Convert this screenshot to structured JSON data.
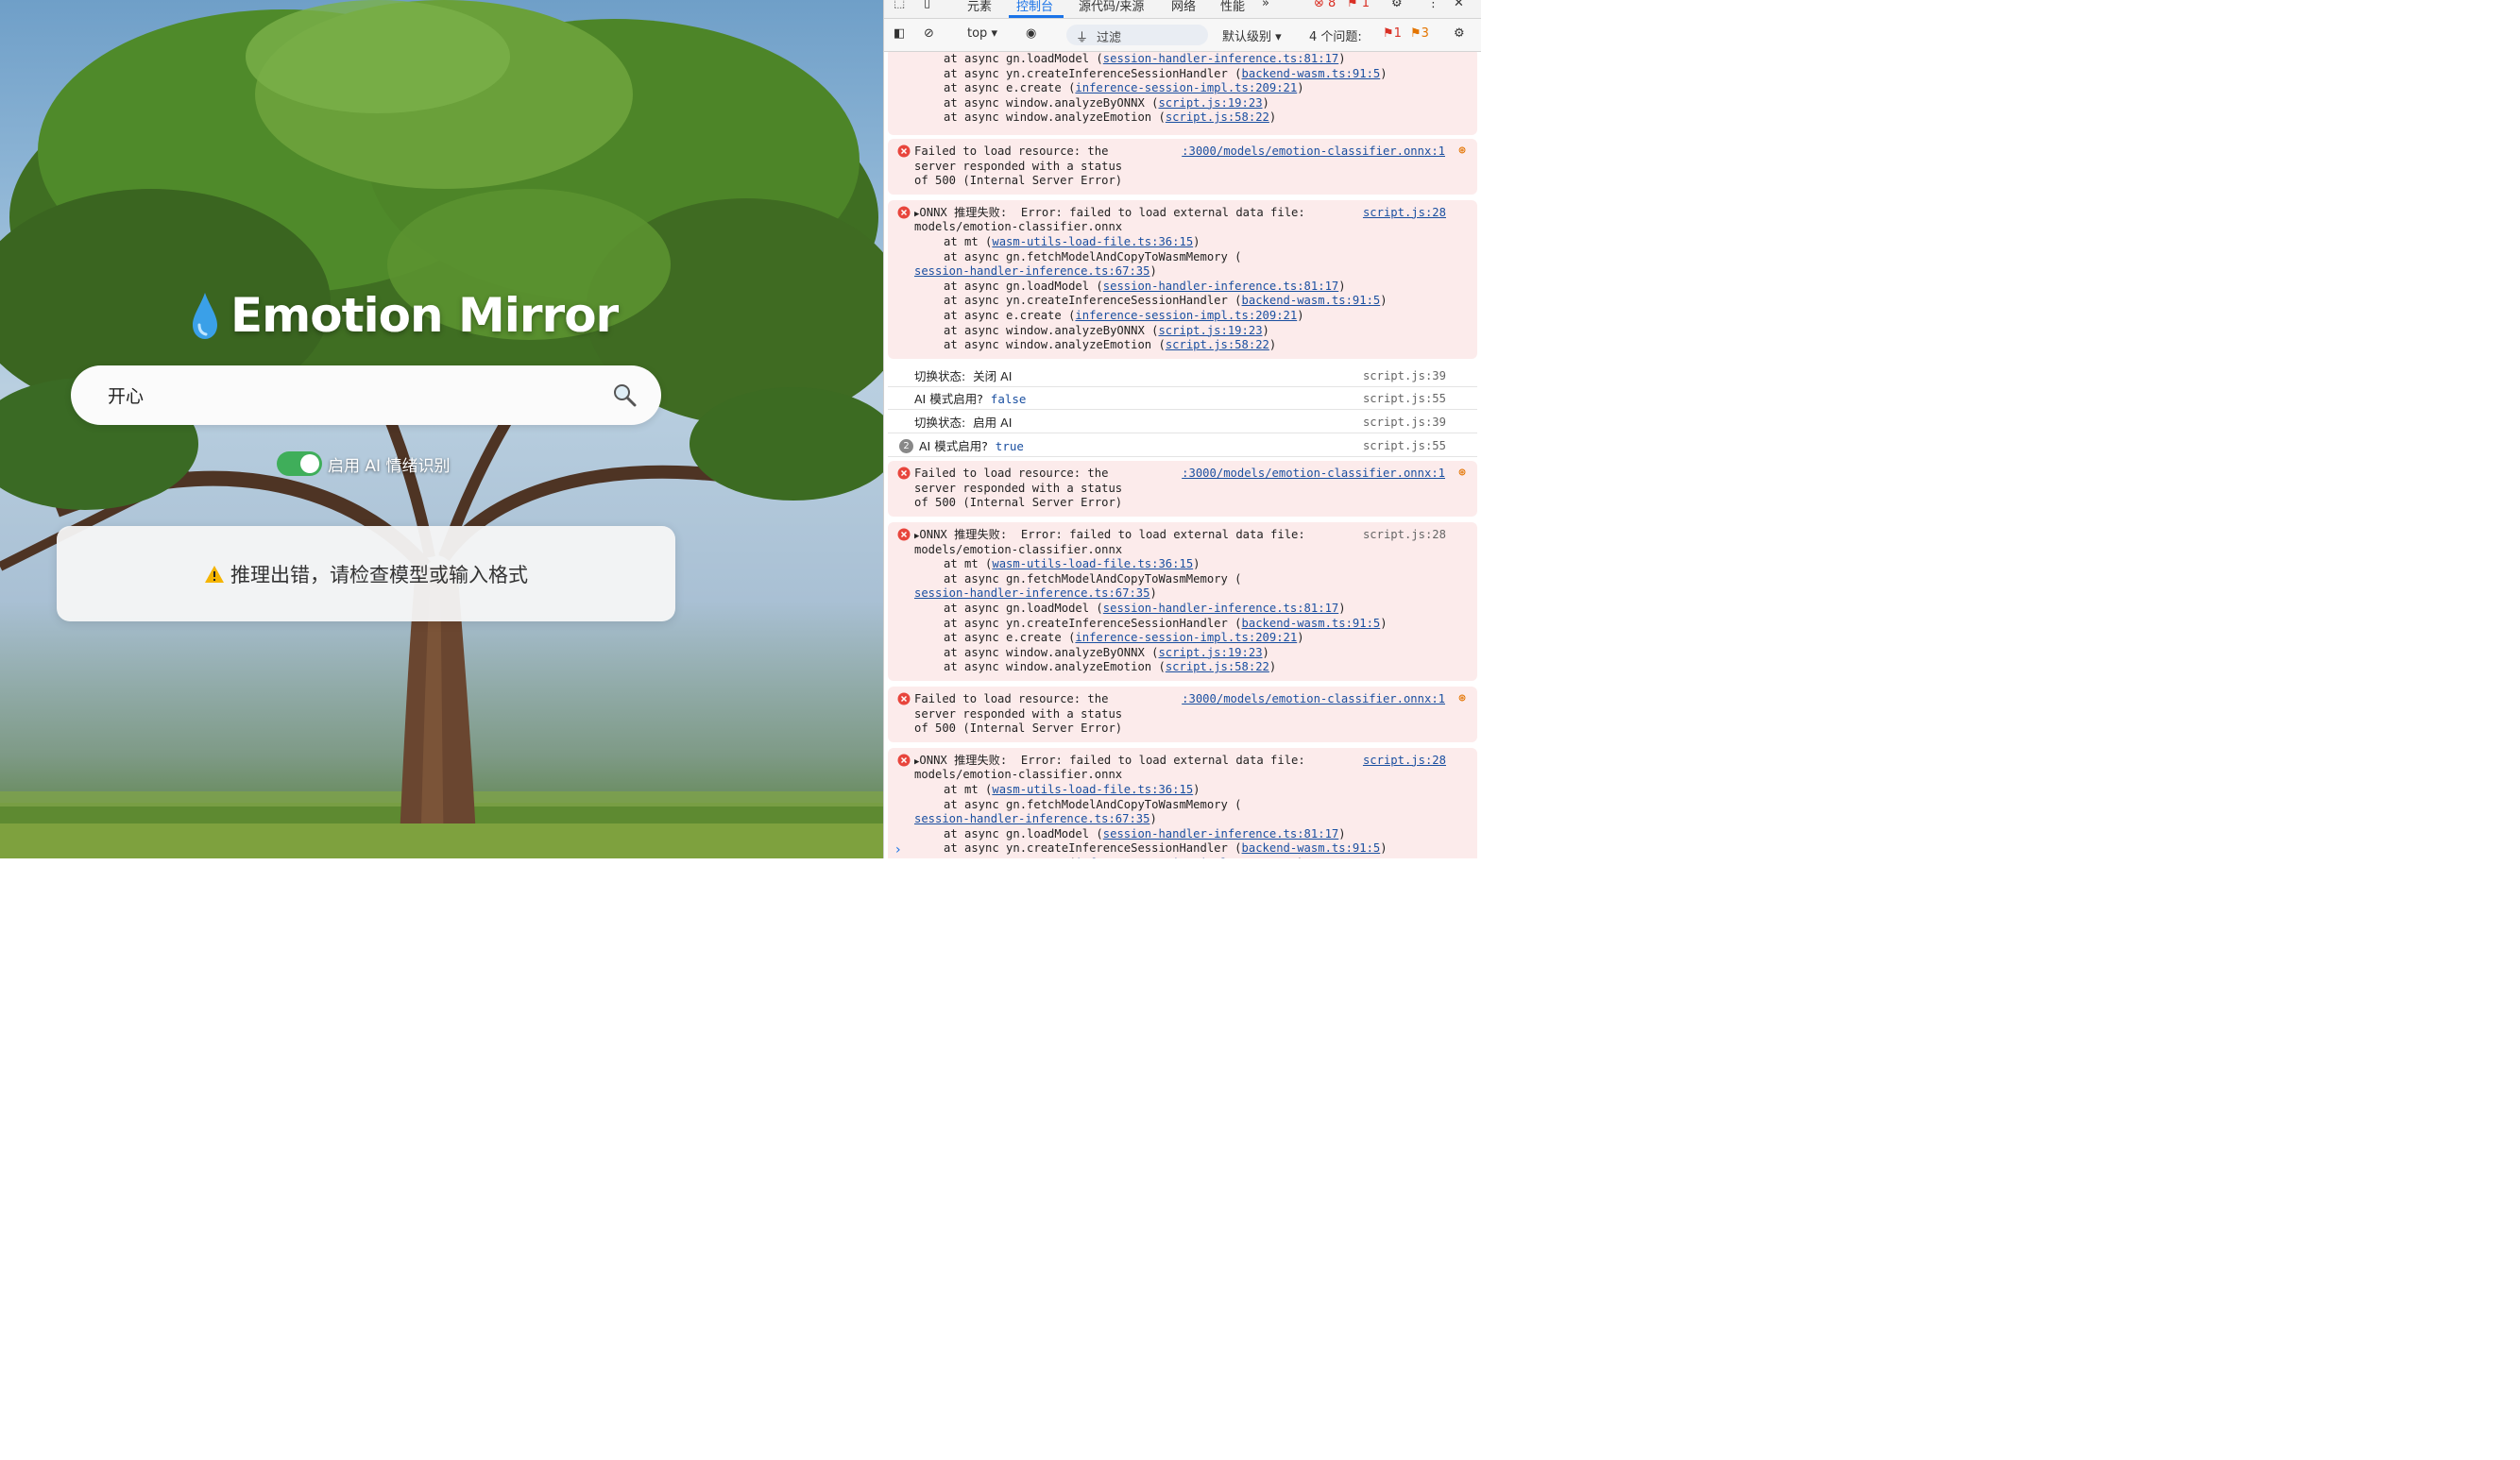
{
  "app": {
    "title": "Emotion Mirror",
    "search": {
      "value": "开心"
    },
    "ai_toggle": {
      "label": "启用 AI 情绪识别",
      "on": true
    },
    "result": {
      "text": "推理出错，请检查模型或输入格式"
    },
    "icons": {
      "title": "water-drop-icon",
      "search": "magnifier-icon",
      "result": "warning-icon"
    }
  },
  "devtools": {
    "tabs": [
      "元素",
      "控制台",
      "源代码/来源",
      "网络",
      "性能"
    ],
    "active_tab": "控制台",
    "error_count": "8",
    "issue_flag_count": "1",
    "context": "top",
    "filter_placeholder": "过滤",
    "level": "默认级别",
    "issues_label": "4 个问题:",
    "issues_errors": "1",
    "issues_warnings": "3",
    "stack_top": [
      {
        "pre": "at async gn.loadModel (",
        "link": "session-handler-inference.ts:81:17",
        "post": ")"
      },
      {
        "pre": "at async yn.createInferenceSessionHandler (",
        "link": "backend-wasm.ts:91:5",
        "post": ")"
      },
      {
        "pre": "at async e.create (",
        "link": "inference-session-impl.ts:209:21",
        "post": ")"
      },
      {
        "pre": "at async window.analyzeByONNX (",
        "link": "script.js:19:23",
        "post": ")"
      },
      {
        "pre": "at async window.analyzeEmotion (",
        "link": "script.js:58:22",
        "post": ")"
      }
    ],
    "failed": {
      "lines": [
        "Failed to load resource: the",
        "server responded with a status",
        "of 500 (Internal Server Error)"
      ],
      "source": ":3000/models/emotion-classifier.onnx:1"
    },
    "onnx": {
      "head": "ONNX 推理失败:  Error: failed to load external data file:",
      "file": "models/emotion-classifier.onnx",
      "source": "script.js:28",
      "stack": [
        {
          "pre": "at mt (",
          "link": "wasm-utils-load-file.ts:36:15",
          "post": ")"
        },
        {
          "pre": "at async gn.fetchModelAndCopyToWasmMemory (",
          "link": "",
          "post": ""
        },
        {
          "pre": "",
          "link": "session-handler-inference.ts:67:35",
          "post": ")"
        },
        {
          "pre": "at async gn.loadModel (",
          "link": "session-handler-inference.ts:81:17",
          "post": ")"
        },
        {
          "pre": "at async yn.createInferenceSessionHandler (",
          "link": "backend-wasm.ts:91:5",
          "post": ")"
        },
        {
          "pre": "at async e.create (",
          "link": "inference-session-impl.ts:209:21",
          "post": ")"
        },
        {
          "pre": "at async window.analyzeByONNX (",
          "link": "script.js:19:23",
          "post": ")"
        },
        {
          "pre": "at async window.analyzeEmotion (",
          "link": "script.js:58:22",
          "post": ")"
        }
      ]
    },
    "logs": [
      {
        "label": "切换状态:",
        "value": "关闭 AI",
        "source": "script.js:39",
        "count": ""
      },
      {
        "label": "AI 模式启用?",
        "value": "false",
        "source": "script.js:55",
        "count": ""
      },
      {
        "label": "切换状态:",
        "value": "启用 AI",
        "source": "script.js:39",
        "count": ""
      },
      {
        "label": "AI 模式启用?",
        "value": "true",
        "source": "script.js:55",
        "count": "2"
      }
    ]
  }
}
